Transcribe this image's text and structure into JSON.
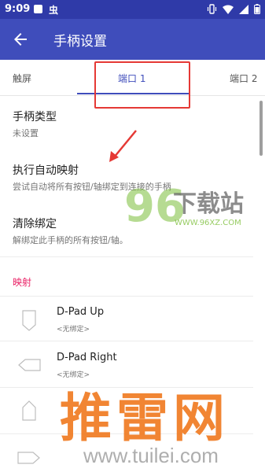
{
  "status": {
    "time": "9:09",
    "app_glyph": "虫"
  },
  "toolbar": {
    "title": "手柄设置",
    "back_icon": "arrow-left-icon"
  },
  "tabs": [
    {
      "label": "触屏"
    },
    {
      "label": "端口 1"
    },
    {
      "label": "端口 2"
    }
  ],
  "prefs": [
    {
      "title": "手柄类型",
      "subtitle": "未设置"
    },
    {
      "title": "执行自动映射",
      "subtitle": "尝试自动将所有按钮/轴绑定到连接的手柄"
    },
    {
      "title": "清除绑定",
      "subtitle": "解绑定此手柄的所有按钮/轴。"
    }
  ],
  "section": {
    "label": "映射"
  },
  "mappings": [
    {
      "title": "D-Pad Up",
      "subtitle": "<无绑定>",
      "icon": "dpad-up-icon"
    },
    {
      "title": "D-Pad Right",
      "subtitle": "<无绑定>",
      "icon": "dpad-right-icon"
    },
    {
      "title": "",
      "subtitle": "",
      "icon": "dpad-down-icon"
    },
    {
      "title": "",
      "subtitle": "",
      "icon": "dpad-left-icon"
    }
  ],
  "watermarks": {
    "top_number": "96",
    "top_text": "下载站",
    "top_url": "WWW.96XZ.COM",
    "bottom_text": "推雷网",
    "bottom_url": "www.tuilei.com"
  },
  "colors": {
    "status_bar": "#2f3aa8",
    "app_bar": "#3f4dbb",
    "section_accent": "#e91e63",
    "annotation": "#e53935"
  }
}
